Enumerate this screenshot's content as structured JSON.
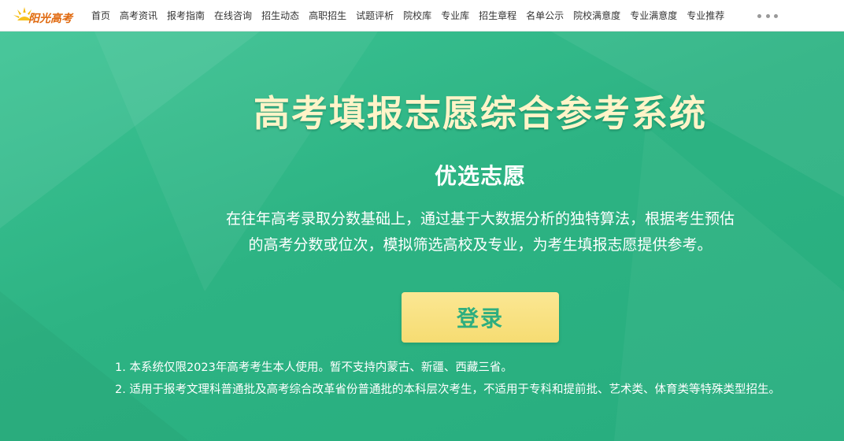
{
  "logo": {
    "text": "阳光高考",
    "icon": "sun-logo-icon",
    "color": "#e06a10"
  },
  "nav": {
    "items": [
      "首页",
      "高考资讯",
      "报考指南",
      "在线咨询",
      "招生动态",
      "高职招生",
      "试题评析",
      "院校库",
      "专业库",
      "招生章程",
      "名单公示",
      "院校满意度",
      "专业满意度",
      "专业推荐"
    ],
    "more_icon": "more-dots-icon"
  },
  "hero": {
    "title": "高考填报志愿综合参考系统",
    "subtitle": "优选志愿",
    "description_line1": "在往年高考录取分数基础上，通过基于大数据分析的独特算法，根据考生预估",
    "description_line2": "的高考分数或位次，模拟筛选高校及专业，为考生填报志愿提供参考。",
    "login_label": "登录",
    "notes": [
      "1. 本系统仅限2023年高考考生本人使用。暂不支持内蒙古、新疆、西藏三省。",
      "2. 适用于报考文理科普通批及高考综合改革省份普通批的本科层次考生，不适用于专科和提前批、艺术类、体育类等特殊类型招生。"
    ]
  },
  "colors": {
    "background": "#2fb586",
    "title": "#fff4c8",
    "button": "#f6dc72",
    "button_text": "#2eae7f"
  }
}
